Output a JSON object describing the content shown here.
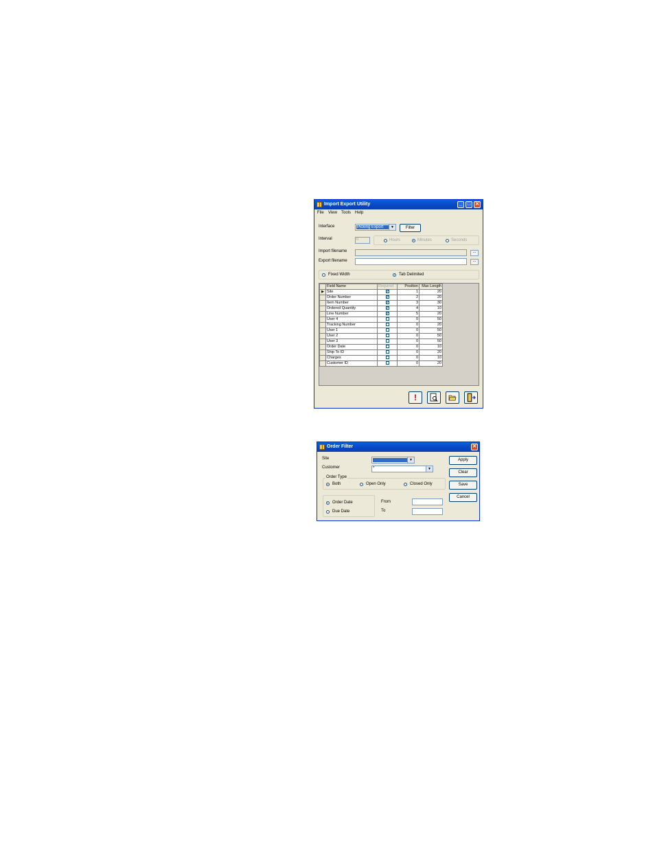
{
  "import_export": {
    "title": "Import Export Utility",
    "menu": [
      "File",
      "View",
      "Tools",
      "Help"
    ],
    "interface_label": "Interface",
    "interface_value": "Picking Export",
    "filter_button": "Filter",
    "interval_label": "Interval",
    "interval_value": "0",
    "interval_units": [
      {
        "label": "Hours",
        "selected": false
      },
      {
        "label": "Minutes",
        "selected": true
      },
      {
        "label": "Seconds",
        "selected": false
      }
    ],
    "import_filename_label": "Import filename",
    "export_filename_label": "Export filename",
    "browse_label": "...",
    "format_options": [
      {
        "label": "Fixed Width",
        "selected": false
      },
      {
        "label": "Tab Delimited",
        "selected": true
      }
    ],
    "columns": [
      "Field Name",
      "Required",
      "Position",
      "Max Length"
    ],
    "current_row_marker": "▶",
    "rows": [
      {
        "field": "Site",
        "required": true,
        "position": "1",
        "max_length": "20"
      },
      {
        "field": "Order Number",
        "required": true,
        "position": "2",
        "max_length": "20"
      },
      {
        "field": "Item Number",
        "required": true,
        "position": "3",
        "max_length": "30"
      },
      {
        "field": "Ordered Quantity",
        "required": true,
        "position": "4",
        "max_length": "10"
      },
      {
        "field": "Line Number",
        "required": true,
        "position": "5",
        "max_length": "20"
      },
      {
        "field": "User 4",
        "required": false,
        "position": "0",
        "max_length": "50"
      },
      {
        "field": "Tracking Number",
        "required": false,
        "position": "0",
        "max_length": "20"
      },
      {
        "field": "User 1",
        "required": false,
        "position": "0",
        "max_length": "50"
      },
      {
        "field": "User 2",
        "required": false,
        "position": "0",
        "max_length": "50"
      },
      {
        "field": "User 3",
        "required": false,
        "position": "0",
        "max_length": "50"
      },
      {
        "field": "Order Date",
        "required": false,
        "position": "0",
        "max_length": "10"
      },
      {
        "field": "Ship To ID",
        "required": false,
        "position": "0",
        "max_length": "20"
      },
      {
        "field": "Charges",
        "required": false,
        "position": "0",
        "max_length": "10"
      },
      {
        "field": "Customer ID",
        "required": false,
        "position": "0",
        "max_length": "20"
      }
    ]
  },
  "order_filter": {
    "title": "Order Filter",
    "site_label": "Site",
    "customer_label": "Customer",
    "customer_value": "*",
    "order_type_label": "Order Type",
    "order_type_options": [
      {
        "label": "Both",
        "selected": true
      },
      {
        "label": "Open Only",
        "selected": false
      },
      {
        "label": "Closed Only",
        "selected": false
      }
    ],
    "date_options": [
      {
        "label": "Order Date",
        "selected": true
      },
      {
        "label": "Due Date",
        "selected": false
      }
    ],
    "from_label": "From",
    "to_label": "To",
    "buttons": [
      "Apply",
      "Clear",
      "Save",
      "Cancel"
    ]
  }
}
